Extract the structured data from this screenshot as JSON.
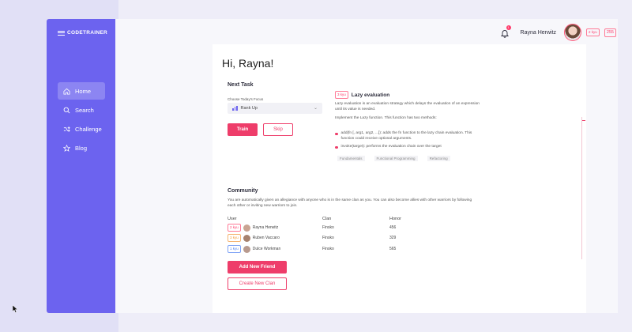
{
  "brand": {
    "logo_text": "CODETRAINER"
  },
  "nav": [
    {
      "label": "Home",
      "icon": "home-icon",
      "active": true
    },
    {
      "label": "Search",
      "icon": "search-icon",
      "active": false
    },
    {
      "label": "Challenge",
      "icon": "shuffle-icon",
      "active": false
    },
    {
      "label": "Blog",
      "icon": "star-icon",
      "active": false
    }
  ],
  "header": {
    "notification_count": "1",
    "user_name": "Rayna Herwitz",
    "kyu": "2 kyu",
    "honor": "255"
  },
  "greeting": "Hi, Rayna!",
  "next_task": {
    "title": "Next Task",
    "focus_label": "Choose Today's Focus",
    "focus_value": "Rank Up",
    "train_label": "Train",
    "skip_label": "Skip"
  },
  "task": {
    "kyu": "3 kyu",
    "title": "Lazy evaluation",
    "description": "Lazy evaluation is an evaluation strategy which delays the evaluation of an expression until its value is needed.",
    "implement": "Implement the Lazy function. This function has two methods:",
    "bullet1": "add(fn [, arg1, arg2, ...]): adds the fn function to the lazy chain evaluation. This function could receive optional arguments.",
    "bullet2": "invoke(target): performs the evaluation chain over the target",
    "tags": [
      "Fundamentals",
      "Functional Programming",
      "Refactoring"
    ]
  },
  "community": {
    "title": "Community",
    "description": "You are automatically given an allegiance with anyone who is in the same clan as you. You can also become allies with other warriors by following each other or inviting new warriors to join.",
    "columns": {
      "user": "User",
      "clan": "Clan",
      "honor": "Honor"
    },
    "rows": [
      {
        "kyu": "2 kyu",
        "kyu_color": "pink",
        "name": "Rayna Herwitz",
        "clan": "Finsko",
        "honor": "456",
        "avatar_color": "#c9a492"
      },
      {
        "kyu": "3 kyu",
        "kyu_color": "orange",
        "name": "Ruben Vaccaro",
        "clan": "Finsko",
        "honor": "329",
        "avatar_color": "#a7826e"
      },
      {
        "kyu": "1 kyu",
        "kyu_color": "blue",
        "name": "Dulce Workman",
        "clan": "Finsko",
        "honor": "565",
        "avatar_color": "#b89a8e"
      }
    ],
    "add_friend_label": "Add New Friend",
    "create_clan_label": "Create New Clan"
  },
  "colors": {
    "sidebar": "#6c63ef",
    "accent": "#ee3d6a"
  }
}
